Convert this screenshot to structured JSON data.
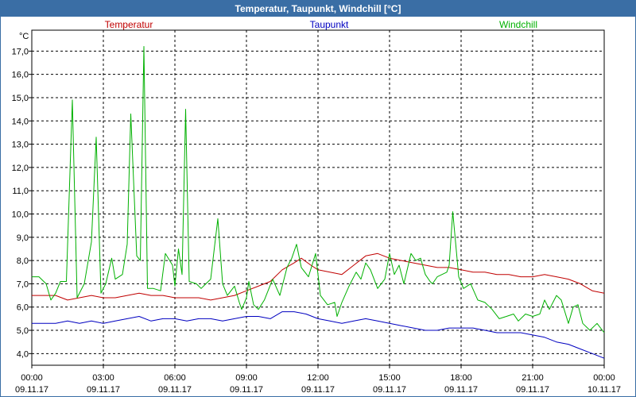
{
  "window": {
    "title": "Temperatur, Taupunkt, Windchill [°C]"
  },
  "chart_data": {
    "type": "line",
    "title": "Temperatur, Taupunkt, Windchill [°C]",
    "ylabel": "°C",
    "ylim": [
      3.5,
      17.9
    ],
    "yticks": [
      "4,0",
      "5,0",
      "6,0",
      "7,0",
      "8,0",
      "9,0",
      "10,0",
      "11,0",
      "12,0",
      "13,0",
      "14,0",
      "15,0",
      "16,0",
      "17,0"
    ],
    "xticks": [
      {
        "time": "00:00",
        "date": "09.11.17"
      },
      {
        "time": "03:00",
        "date": "09.11.17"
      },
      {
        "time": "06:00",
        "date": "09.11.17"
      },
      {
        "time": "09:00",
        "date": "09.11.17"
      },
      {
        "time": "12:00",
        "date": "09.11.17"
      },
      {
        "time": "15:00",
        "date": "09.11.17"
      },
      {
        "time": "18:00",
        "date": "09.11.17"
      },
      {
        "time": "21:00",
        "date": "09.11.17"
      },
      {
        "time": "00:00",
        "date": "10.11.17"
      }
    ],
    "x_unit": "hours since 00:00 09.11.17",
    "grid": true,
    "legend_position": "top",
    "series": [
      {
        "name": "Temperatur",
        "color": "#c00000",
        "points": [
          [
            0,
            6.5
          ],
          [
            0.5,
            6.5
          ],
          [
            1,
            6.5
          ],
          [
            1.5,
            6.3
          ],
          [
            2,
            6.4
          ],
          [
            2.5,
            6.5
          ],
          [
            3,
            6.4
          ],
          [
            3.5,
            6.4
          ],
          [
            4,
            6.5
          ],
          [
            4.5,
            6.6
          ],
          [
            5,
            6.5
          ],
          [
            5.5,
            6.5
          ],
          [
            6,
            6.4
          ],
          [
            6.5,
            6.4
          ],
          [
            7,
            6.4
          ],
          [
            7.5,
            6.3
          ],
          [
            8,
            6.4
          ],
          [
            8.5,
            6.5
          ],
          [
            9,
            6.7
          ],
          [
            9.5,
            6.9
          ],
          [
            10,
            7.1
          ],
          [
            10.5,
            7.6
          ],
          [
            11,
            7.9
          ],
          [
            11.3,
            8.1
          ],
          [
            11.7,
            7.8
          ],
          [
            12,
            7.6
          ],
          [
            12.5,
            7.5
          ],
          [
            13,
            7.4
          ],
          [
            13.5,
            7.8
          ],
          [
            14,
            8.2
          ],
          [
            14.5,
            8.3
          ],
          [
            15,
            8.1
          ],
          [
            15.5,
            8.0
          ],
          [
            16,
            7.9
          ],
          [
            16.5,
            7.8
          ],
          [
            17,
            7.7
          ],
          [
            17.5,
            7.7
          ],
          [
            18,
            7.6
          ],
          [
            18.5,
            7.5
          ],
          [
            19,
            7.5
          ],
          [
            19.5,
            7.4
          ],
          [
            20,
            7.4
          ],
          [
            20.5,
            7.3
          ],
          [
            21,
            7.3
          ],
          [
            21.5,
            7.4
          ],
          [
            22,
            7.3
          ],
          [
            22.5,
            7.2
          ],
          [
            23,
            7.0
          ],
          [
            23.5,
            6.7
          ],
          [
            24,
            6.6
          ]
        ]
      },
      {
        "name": "Taupunkt",
        "color": "#0000c0",
        "points": [
          [
            0,
            5.3
          ],
          [
            0.5,
            5.3
          ],
          [
            1,
            5.3
          ],
          [
            1.5,
            5.4
          ],
          [
            2,
            5.3
          ],
          [
            2.5,
            5.4
          ],
          [
            3,
            5.3
          ],
          [
            3.5,
            5.4
          ],
          [
            4,
            5.5
          ],
          [
            4.5,
            5.6
          ],
          [
            5,
            5.4
          ],
          [
            5.5,
            5.5
          ],
          [
            6,
            5.5
          ],
          [
            6.5,
            5.4
          ],
          [
            7,
            5.5
          ],
          [
            7.5,
            5.5
          ],
          [
            8,
            5.4
          ],
          [
            8.5,
            5.5
          ],
          [
            9,
            5.6
          ],
          [
            9.5,
            5.6
          ],
          [
            10,
            5.5
          ],
          [
            10.5,
            5.8
          ],
          [
            11,
            5.8
          ],
          [
            11.5,
            5.7
          ],
          [
            12,
            5.5
          ],
          [
            12.5,
            5.4
          ],
          [
            13,
            5.3
          ],
          [
            13.5,
            5.4
          ],
          [
            14,
            5.5
          ],
          [
            14.5,
            5.4
          ],
          [
            15,
            5.3
          ],
          [
            15.5,
            5.2
          ],
          [
            16,
            5.1
          ],
          [
            16.5,
            5.0
          ],
          [
            17,
            5.0
          ],
          [
            17.5,
            5.1
          ],
          [
            18,
            5.1
          ],
          [
            18.5,
            5.1
          ],
          [
            19,
            5.0
          ],
          [
            19.5,
            4.9
          ],
          [
            20,
            4.9
          ],
          [
            20.5,
            4.9
          ],
          [
            21,
            4.8
          ],
          [
            21.5,
            4.7
          ],
          [
            22,
            4.5
          ],
          [
            22.5,
            4.4
          ],
          [
            23,
            4.2
          ],
          [
            23.5,
            4.0
          ],
          [
            24,
            3.8
          ]
        ]
      },
      {
        "name": "Windchill",
        "color": "#00b000",
        "points": [
          [
            0,
            7.3
          ],
          [
            0.3,
            7.3
          ],
          [
            0.6,
            7.0
          ],
          [
            0.8,
            6.3
          ],
          [
            1.0,
            6.6
          ],
          [
            1.2,
            7.1
          ],
          [
            1.45,
            7.1
          ],
          [
            1.7,
            14.9
          ],
          [
            1.9,
            6.4
          ],
          [
            2.2,
            7.0
          ],
          [
            2.5,
            8.8
          ],
          [
            2.7,
            13.3
          ],
          [
            2.9,
            6.6
          ],
          [
            3.1,
            7.0
          ],
          [
            3.35,
            8.1
          ],
          [
            3.5,
            7.2
          ],
          [
            3.8,
            7.4
          ],
          [
            4.0,
            8.7
          ],
          [
            4.15,
            14.3
          ],
          [
            4.4,
            8.2
          ],
          [
            4.55,
            8.0
          ],
          [
            4.7,
            17.2
          ],
          [
            4.85,
            6.8
          ],
          [
            5.1,
            6.8
          ],
          [
            5.4,
            6.7
          ],
          [
            5.6,
            8.3
          ],
          [
            5.9,
            7.8
          ],
          [
            6.0,
            6.9
          ],
          [
            6.15,
            8.5
          ],
          [
            6.3,
            7.4
          ],
          [
            6.45,
            14.5
          ],
          [
            6.6,
            7.1
          ],
          [
            6.9,
            7.0
          ],
          [
            7.1,
            6.8
          ],
          [
            7.3,
            7.0
          ],
          [
            7.5,
            7.2
          ],
          [
            7.8,
            9.8
          ],
          [
            8.0,
            7.0
          ],
          [
            8.2,
            6.5
          ],
          [
            8.5,
            6.9
          ],
          [
            8.7,
            6.2
          ],
          [
            8.8,
            5.9
          ],
          [
            9.0,
            6.4
          ],
          [
            9.1,
            7.1
          ],
          [
            9.3,
            6.1
          ],
          [
            9.5,
            5.9
          ],
          [
            9.75,
            6.3
          ],
          [
            10.1,
            7.2
          ],
          [
            10.4,
            6.5
          ],
          [
            10.7,
            7.7
          ],
          [
            10.9,
            8.1
          ],
          [
            11.1,
            8.7
          ],
          [
            11.3,
            7.7
          ],
          [
            11.6,
            7.3
          ],
          [
            11.9,
            8.3
          ],
          [
            12.1,
            6.5
          ],
          [
            12.4,
            6.1
          ],
          [
            12.7,
            6.2
          ],
          [
            12.8,
            5.6
          ],
          [
            13.0,
            6.2
          ],
          [
            13.3,
            6.9
          ],
          [
            13.6,
            7.5
          ],
          [
            13.8,
            7.2
          ],
          [
            14.0,
            7.9
          ],
          [
            14.2,
            7.6
          ],
          [
            14.5,
            6.8
          ],
          [
            14.8,
            7.2
          ],
          [
            15.0,
            8.3
          ],
          [
            15.2,
            7.4
          ],
          [
            15.4,
            7.8
          ],
          [
            15.6,
            7.0
          ],
          [
            15.9,
            8.3
          ],
          [
            16.1,
            8.0
          ],
          [
            16.3,
            8.1
          ],
          [
            16.5,
            7.4
          ],
          [
            16.7,
            7.1
          ],
          [
            16.8,
            7.0
          ],
          [
            17.0,
            7.3
          ],
          [
            17.2,
            7.4
          ],
          [
            17.4,
            7.5
          ],
          [
            17.5,
            7.8
          ],
          [
            17.65,
            10.1
          ],
          [
            17.9,
            7.3
          ],
          [
            18.1,
            6.8
          ],
          [
            18.4,
            7.0
          ],
          [
            18.7,
            6.3
          ],
          [
            19.0,
            6.2
          ],
          [
            19.3,
            5.9
          ],
          [
            19.6,
            5.5
          ],
          [
            19.9,
            5.6
          ],
          [
            20.2,
            5.7
          ],
          [
            20.4,
            5.4
          ],
          [
            20.7,
            5.7
          ],
          [
            21.0,
            5.6
          ],
          [
            21.3,
            5.7
          ],
          [
            21.5,
            6.3
          ],
          [
            21.7,
            5.9
          ],
          [
            22.0,
            6.5
          ],
          [
            22.2,
            6.3
          ],
          [
            22.5,
            5.3
          ],
          [
            22.7,
            6.0
          ],
          [
            22.9,
            6.1
          ],
          [
            23.1,
            5.3
          ],
          [
            23.4,
            5.0
          ],
          [
            23.7,
            5.3
          ],
          [
            24,
            4.9
          ]
        ]
      }
    ]
  }
}
